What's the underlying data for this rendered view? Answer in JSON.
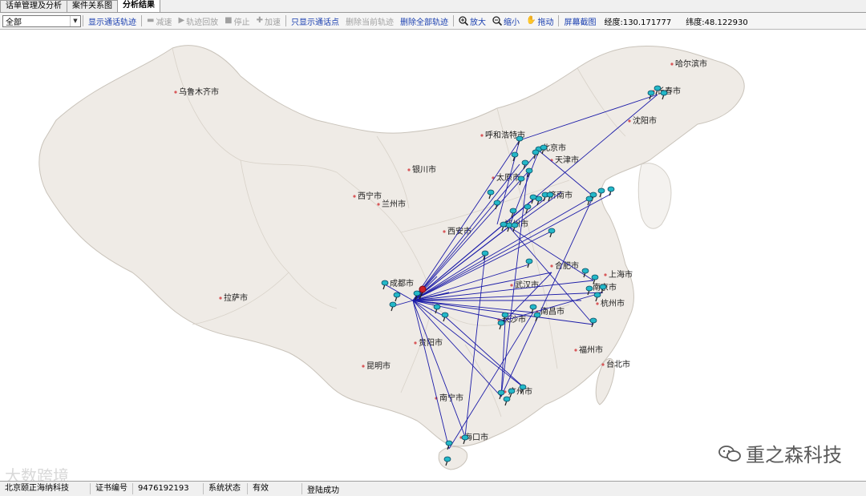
{
  "tabs": [
    {
      "label": "话单管理及分析"
    },
    {
      "label": "案件关系图"
    },
    {
      "label": "分析结果",
      "active": true
    }
  ],
  "toolbar": {
    "select_value": "全部",
    "show_track": "显示通话轨迹",
    "slow": "减速",
    "replay": "轨迹回放",
    "stop": "停止",
    "fast": "加速",
    "only_points": "只显示通话点",
    "delete_current": "删除当前轨迹",
    "delete_all": "删除全部轨迹",
    "zoom_in": "放大",
    "zoom_out": "缩小",
    "pan": "拖动",
    "screenshot": "屏幕截图",
    "lon_label": "经度:",
    "lon_value": "130.171777",
    "lat_label": "纬度:",
    "lat_value": "48.122930"
  },
  "cities": [
    {
      "name": "哈尔滨市"
    },
    {
      "name": "长春市"
    },
    {
      "name": "沈阳市"
    },
    {
      "name": "乌鲁木齐市"
    },
    {
      "name": "呼和浩特市"
    },
    {
      "name": "北京市"
    },
    {
      "name": "天津市"
    },
    {
      "name": "银川市"
    },
    {
      "name": "太原市"
    },
    {
      "name": "西宁市"
    },
    {
      "name": "兰州市"
    },
    {
      "name": "济南市"
    },
    {
      "name": "郑州市"
    },
    {
      "name": "西安市"
    },
    {
      "name": "合肥市"
    },
    {
      "name": "上海市"
    },
    {
      "name": "南京市"
    },
    {
      "name": "杭州市"
    },
    {
      "name": "成都市"
    },
    {
      "name": "武汉市"
    },
    {
      "name": "拉萨市"
    },
    {
      "name": "南昌市"
    },
    {
      "name": "长沙市"
    },
    {
      "name": "福州市"
    },
    {
      "name": "贵阳市"
    },
    {
      "name": "台北市"
    },
    {
      "name": "昆明市"
    },
    {
      "name": "广州市"
    },
    {
      "name": "南宁市"
    },
    {
      "name": "海口市"
    }
  ],
  "status": {
    "company": "北京颐正海纳科技",
    "cert_label": "证书编号",
    "cert_value": "9476192193",
    "sys_label": "系统状态",
    "sys_value": "有效",
    "login": "登陆成功"
  },
  "watermark": {
    "brand": "重之森科技",
    "corner": "大数跨境"
  },
  "colors": {
    "track": "#1c1ca8",
    "pin": "#23b8c8",
    "land": "#efebe6",
    "border": "#c9c3ba",
    "city_dot": "#d8585a"
  }
}
